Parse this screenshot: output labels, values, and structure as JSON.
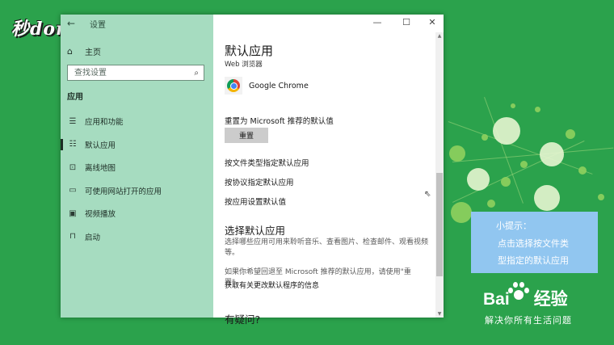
{
  "watermark": {
    "brand": "秒dong视频"
  },
  "sidebar": {
    "header": "设置",
    "home_label": "主页",
    "search_placeholder": "查找设置",
    "section_label": "应用",
    "items": [
      {
        "label": "应用和功能",
        "icon": "list-icon",
        "active": false
      },
      {
        "label": "默认应用",
        "icon": "default-apps-icon",
        "active": true
      },
      {
        "label": "离线地图",
        "icon": "map-icon",
        "active": false
      },
      {
        "label": "可使用网站打开的应用",
        "icon": "website-icon",
        "active": false
      },
      {
        "label": "视频播放",
        "icon": "video-icon",
        "active": false
      },
      {
        "label": "启动",
        "icon": "startup-icon",
        "active": false
      }
    ]
  },
  "window_controls": {
    "minimize": "—",
    "maximize": "☐",
    "close": "✕"
  },
  "main": {
    "title": "默认应用",
    "web_browser_label": "Web 浏览器",
    "browser_name": "Google Chrome",
    "reset_label": "重置为 Microsoft 推荐的默认值",
    "reset_button": "重置",
    "links": [
      "按文件类型指定默认应用",
      "按协议指定默认应用",
      "按应用设置默认值"
    ],
    "choose_heading": "选择默认应用",
    "choose_desc": "选择哪些应用可用来聆听音乐、查看图片、检查邮件、观看视频等。",
    "reset_hint": "如果你希望回退至 Microsoft 推荐的默认应用，请使用\"重置\"。",
    "info_link": "获取有关更改默认程序的信息",
    "next_heading": "有疑问?"
  },
  "tip": {
    "title": "小提示：",
    "line1": "点击选择按文件类",
    "line2": "型指定的默认应用"
  },
  "baidu": {
    "name": "Bai",
    "name_suffix": "经验",
    "slogan": "解决你所有生活问题"
  }
}
